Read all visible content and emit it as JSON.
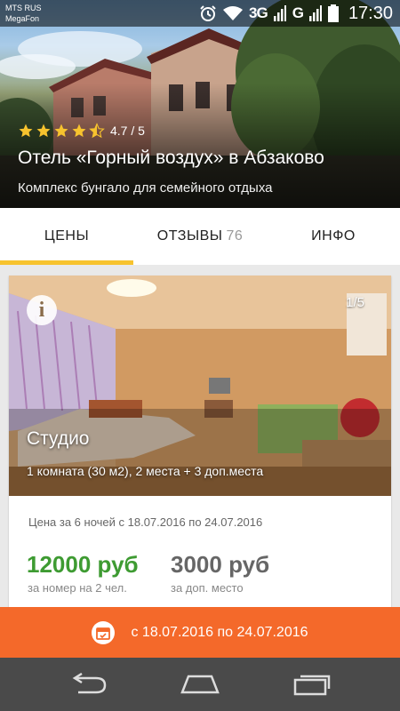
{
  "status_bar": {
    "carrier_1": "MTS RUS",
    "carrier_2": "MegaFon",
    "network_1": "3G",
    "network_2": "G",
    "time": "17:30",
    "icons": [
      "alarm-icon",
      "wifi-icon",
      "signal-icon",
      "battery-icon"
    ]
  },
  "hotel": {
    "rating_stars": 4.7,
    "rating_text": "4.7 / 5",
    "title": "Отель «Горный воздух» в Абзаково",
    "subtitle": "Комплекс бунгало для семейного отдыха"
  },
  "tabs": [
    {
      "label": "ЦЕНЫ",
      "count": "",
      "active": true
    },
    {
      "label": "ОТЗЫВЫ",
      "count": "76",
      "active": false
    },
    {
      "label": "ИНФО",
      "count": "",
      "active": false
    }
  ],
  "room": {
    "photo_counter": "1/5",
    "name": "Студио",
    "description": "1 комната (30 м2),  2 места + 3 доп.места",
    "price_note": "Цена за 6 ночей с 18.07.2016 по 24.07.2016",
    "price_main": "12000 руб",
    "price_main_sub": "за номер на 2 чел.",
    "price_extra": "3000 руб",
    "price_extra_sub": "за доп. место"
  },
  "date_bar": {
    "label": "с 18.07.2016 по 24.07.2016"
  },
  "colors": {
    "accent_tab": "#f7c32e",
    "price_green": "#3e9b32",
    "date_bar": "#f4692a",
    "nav_bar": "#4a4a4a"
  }
}
